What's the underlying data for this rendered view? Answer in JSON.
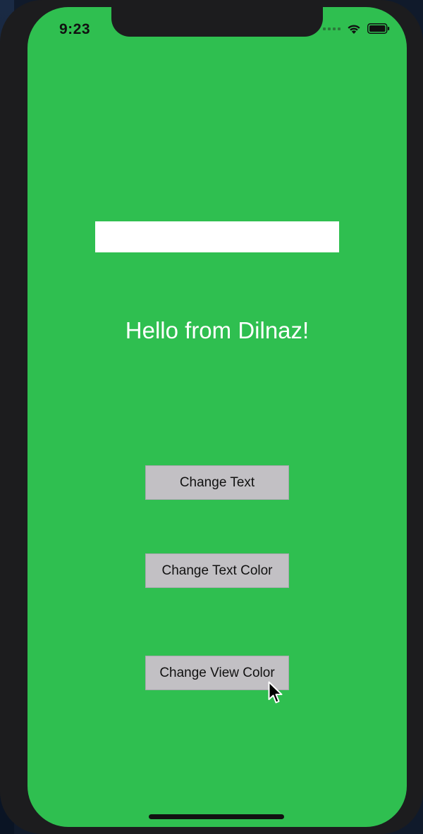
{
  "status_bar": {
    "time": "9:23"
  },
  "screen": {
    "background": "#2fbf50",
    "text_field": {
      "value": "",
      "placeholder": ""
    },
    "label": {
      "text": "Hello from Dilnaz!",
      "color": "#ffffff"
    },
    "buttons": [
      {
        "label": "Change Text"
      },
      {
        "label": "Change Text Color"
      },
      {
        "label": "Change View Color"
      }
    ]
  },
  "icons": {
    "signal": "cellular-signal-icon",
    "wifi": "wifi-icon",
    "battery": "battery-icon",
    "cursor": "mouse-pointer-icon"
  }
}
